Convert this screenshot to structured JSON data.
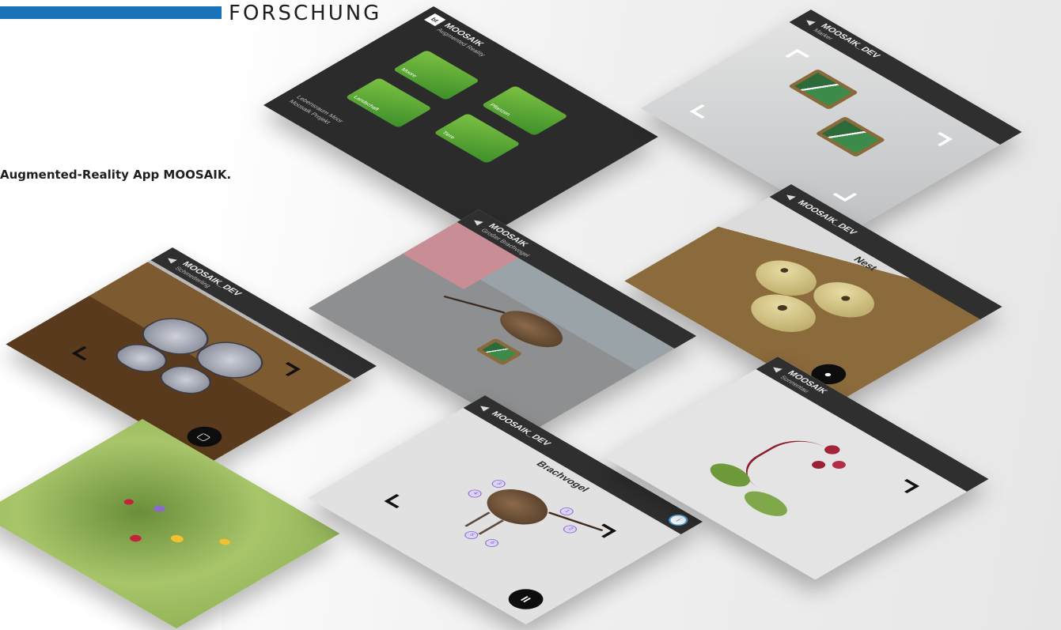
{
  "header": {
    "section_title": "FORSCHUNG",
    "accent_color": "#1b73b9"
  },
  "caption": "Augmented-Reality App MOOSAIK.",
  "screens": {
    "menu": {
      "logo": "bt",
      "title": "MOOSAIK",
      "subtitle": "Augmented Reality",
      "tiles": [
        "Moore",
        "Pflanzen",
        "Tiere",
        "Landschaft"
      ],
      "footer_line1": "Lebensraum Moor",
      "footer_line2": "Moosaik Projekt"
    },
    "markers": {
      "title": "MOOSAIK_DEV",
      "subtitle": "Marker"
    },
    "nest": {
      "title": "MOOSAIK_DEV",
      "label": "Nest"
    },
    "butterfly": {
      "title": "MOOSAIK_DEV",
      "subtitle": "Schmetterling"
    },
    "curlew_photo": {
      "title": "MOOSAIK",
      "subtitle": "Großer Brachvogel"
    },
    "brachvogel": {
      "title": "MOOSAIK_DEV",
      "label": "Brachvogel",
      "info_badge": "i",
      "fab_icon": "II",
      "markers": [
        "1",
        "2",
        "3",
        "4",
        "5",
        "6"
      ]
    },
    "plant": {
      "title": "MOOSAIK",
      "subtitle": "Sonnentau"
    },
    "meadow": {}
  },
  "icons": {
    "back": "arrow-left-icon",
    "fab": "pause-icon",
    "info": "info-icon"
  }
}
